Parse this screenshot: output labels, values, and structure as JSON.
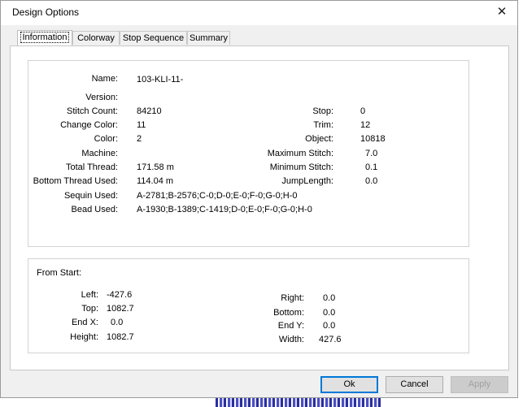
{
  "window": {
    "title": "Design Options"
  },
  "tabs": [
    "Information",
    "Colorway",
    "Stop Sequence",
    "Summary"
  ],
  "info": {
    "left": [
      {
        "label": "Name:",
        "value": "103-KLI-11-"
      },
      {
        "label": "Version:",
        "value": ""
      },
      {
        "label": "Stitch Count:",
        "value": "84210"
      },
      {
        "label": "Change Color:",
        "value": "11"
      },
      {
        "label": "Color:",
        "value": "2"
      },
      {
        "label": "Machine:",
        "value": ""
      },
      {
        "label": "Total Thread:",
        "value": "171.58 m"
      },
      {
        "label": "Bottom Thread Used:",
        "value": "114.04 m"
      },
      {
        "label": "Sequin Used:",
        "value": "A-2781;B-2576;C-0;D-0;E-0;F-0;G-0;H-0"
      },
      {
        "label": "Bead Used:",
        "value": "A-1930;B-1389;C-1419;D-0;E-0;F-0;G-0;H-0"
      }
    ],
    "right": [
      {
        "label": "Stop:",
        "value": "0"
      },
      {
        "label": "Trim:",
        "value": "12"
      },
      {
        "label": "Object:",
        "value": "10818"
      },
      {
        "label": "Maximum Stitch:",
        "value": "7.0"
      },
      {
        "label": "Minimum Stitch:",
        "value": "0.1"
      },
      {
        "label": "JumpLength:",
        "value": "0.0"
      }
    ]
  },
  "from_start": {
    "heading": "From Start:",
    "left": [
      {
        "label": "Left:",
        "value": "-427.6"
      },
      {
        "label": "Top:",
        "value": "1082.7"
      },
      {
        "label": "End X:",
        "value": "0.0"
      },
      {
        "label": "Height:",
        "value": "1082.7"
      }
    ],
    "right": [
      {
        "label": "Right:",
        "value": "0.0"
      },
      {
        "label": "Bottom:",
        "value": "0.0"
      },
      {
        "label": "End Y:",
        "value": "0.0"
      },
      {
        "label": "Width:",
        "value": "427.6"
      }
    ]
  },
  "buttons": {
    "ok": "Ok",
    "cancel": "Cancel",
    "apply": "Apply"
  },
  "icons": {
    "close": "close-icon"
  },
  "colors": {
    "default_button_border": "#0078d7",
    "window_bg": "#f0f0f0"
  }
}
